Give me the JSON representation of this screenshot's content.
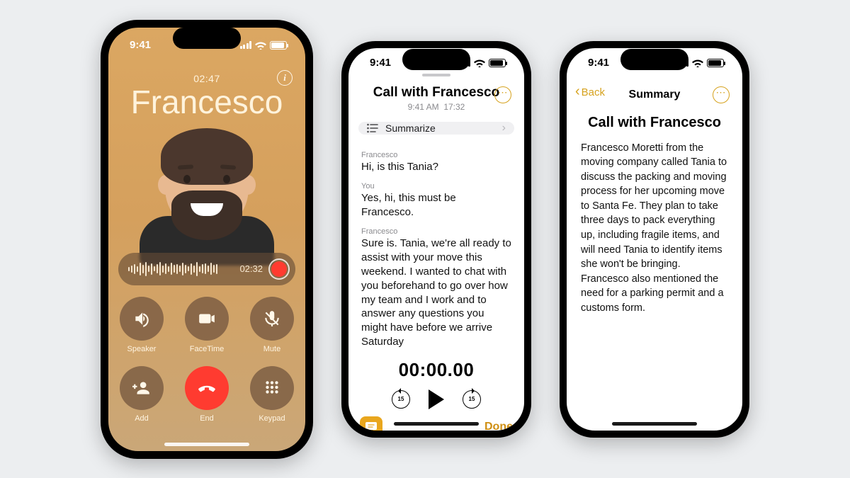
{
  "status": {
    "time": "9:41"
  },
  "phone1": {
    "duration": "02:47",
    "caller": "Francesco",
    "recording_time": "02:32",
    "buttons": {
      "speaker": "Speaker",
      "facetime": "FaceTime",
      "mute": "Mute",
      "add": "Add",
      "end": "End",
      "keypad": "Keypad"
    }
  },
  "phone2": {
    "title": "Call with Francesco",
    "started_at": "9:41 AM",
    "length": "17:32",
    "summarize_label": "Summarize",
    "transcript": [
      {
        "speaker": "Francesco",
        "text": "Hi, is this Tania?"
      },
      {
        "speaker": "You",
        "text": "Yes, hi, this must be Francesco."
      },
      {
        "speaker": "Francesco",
        "text": "Sure is. Tania, we're all ready to assist with your move this weekend. I wanted to chat with you beforehand to go over how my team and I work and to answer any questions you might have before we arrive Saturday"
      }
    ],
    "player_time": "00:00.00",
    "done_label": "Done"
  },
  "phone3": {
    "back_label": "Back",
    "nav_title": "Summary",
    "heading": "Call with Francesco",
    "body": "Francesco Moretti from the moving company called Tania to discuss the packing and moving process for her upcoming move to Santa Fe. They plan to take three days to pack everything up, including fragile items, and will need Tania to identify items she won't be bringing. Francesco also mentioned the need for a parking permit and a customs form."
  }
}
